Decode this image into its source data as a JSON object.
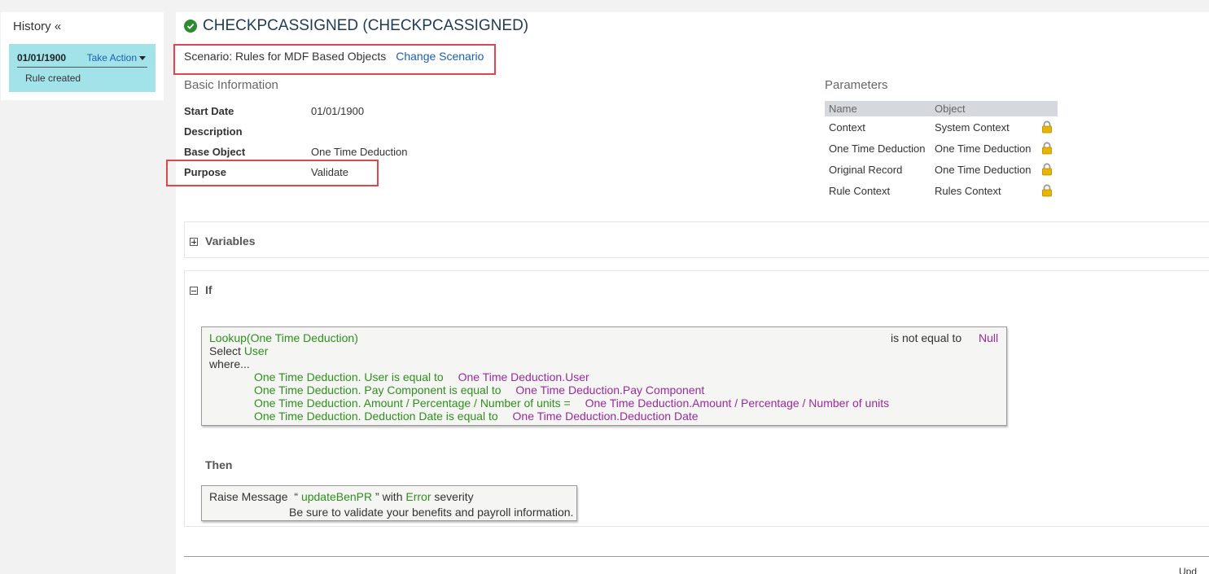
{
  "history": {
    "title": "History «",
    "entries": [
      {
        "date": "01/01/1900",
        "action": "Take Action",
        "note": "Rule created"
      }
    ]
  },
  "rule": {
    "title": "CHECKPCASSIGNED (CHECKPCASSIGNED)",
    "scenario_text": "Scenario: Rules for MDF Based Objects",
    "change_scenario": "Change Scenario"
  },
  "basic_info": {
    "heading": "Basic Information",
    "fields": [
      {
        "label": "Start Date",
        "value": "01/01/1900"
      },
      {
        "label": "Description",
        "value": ""
      },
      {
        "label": "Base Object",
        "value": "One Time Deduction"
      },
      {
        "label": "Purpose",
        "value": "Validate"
      }
    ]
  },
  "parameters": {
    "heading": "Parameters",
    "columns": [
      "Name",
      "Object"
    ],
    "rows": [
      {
        "name": "Context",
        "object": "System Context"
      },
      {
        "name": "One Time Deduction",
        "object": "One Time Deduction"
      },
      {
        "name": "Original Record",
        "object": "One Time Deduction"
      },
      {
        "name": "Rule Context",
        "object": "Rules Context"
      }
    ]
  },
  "variables": {
    "label": "Variables"
  },
  "if_section": {
    "label": "If",
    "lookup": "Lookup(One Time Deduction)",
    "comparison": "is not equal to",
    "comparison_value": "Null",
    "select_word": "Select",
    "select_field": "User",
    "where_word": "where...",
    "conditions": [
      {
        "field": "One Time Deduction. User",
        "operator": "is equal to",
        "value": "One Time Deduction.User"
      },
      {
        "field": "One Time Deduction. Pay Component",
        "operator": "is equal to",
        "value": "One Time Deduction.Pay Component"
      },
      {
        "field": "One Time Deduction. Amount / Percentage / Number of units",
        "operator": "=",
        "value": "One Time Deduction.Amount / Percentage / Number of units"
      },
      {
        "field": "One Time Deduction. Deduction Date",
        "operator": "is equal to",
        "value": "One Time Deduction.Deduction Date"
      }
    ]
  },
  "then_section": {
    "label": "Then",
    "raise_label": "Raise Message",
    "open_quote": "“",
    "message_key": "updateBenPR",
    "close_with": "” with",
    "severity": "Error",
    "severity_word": "severity",
    "message_text": "Be sure to validate your benefits and payroll information."
  },
  "footer": {
    "cut_text": "Upd"
  },
  "colors": {
    "accent_link": "#1a5fb4",
    "highlight_box": "#e0474c",
    "history_entry_bg": "#a1e3e9",
    "expression_green": "#2f8f1e",
    "expression_purple": "#9b2a9f",
    "success_icon": "#2c8b2c",
    "lock_icon": "#e8b400"
  },
  "icons": [
    "checkmark-circle-icon",
    "lock-icon",
    "expand-plus-icon",
    "collapse-minus-icon",
    "caret-down-icon"
  ]
}
